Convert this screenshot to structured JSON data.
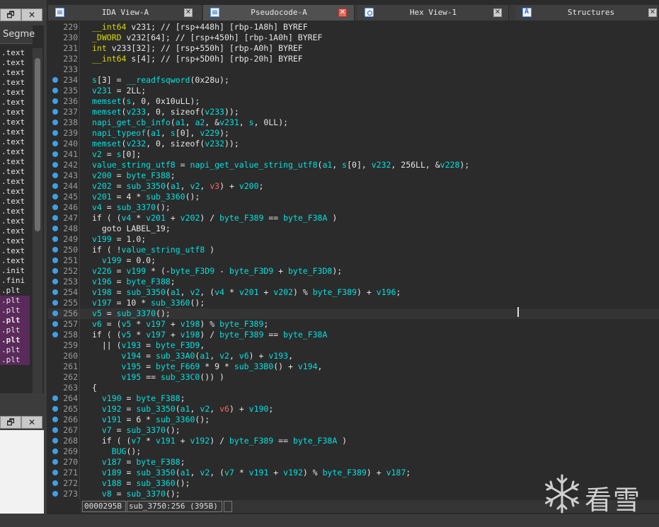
{
  "left_panel": {
    "window_buttons": [
      "🗗",
      "✕"
    ],
    "segments_header": "Segme",
    "segments": [
      {
        "name": ".text",
        "plt": false,
        "bold": false
      },
      {
        "name": ".text",
        "plt": false,
        "bold": false
      },
      {
        "name": ".text",
        "plt": false,
        "bold": false
      },
      {
        "name": ".text",
        "plt": false,
        "bold": false
      },
      {
        "name": ".text",
        "plt": false,
        "bold": false
      },
      {
        "name": ".text",
        "plt": false,
        "bold": false
      },
      {
        "name": ".text",
        "plt": false,
        "bold": false
      },
      {
        "name": ".text",
        "plt": false,
        "bold": false
      },
      {
        "name": ".text",
        "plt": false,
        "bold": false
      },
      {
        "name": ".text",
        "plt": false,
        "bold": false
      },
      {
        "name": ".text",
        "plt": false,
        "bold": false
      },
      {
        "name": ".text",
        "plt": false,
        "bold": false
      },
      {
        "name": ".text",
        "plt": false,
        "bold": false
      },
      {
        "name": ".text",
        "plt": false,
        "bold": false
      },
      {
        "name": ".text",
        "plt": false,
        "bold": false
      },
      {
        "name": ".text",
        "plt": false,
        "bold": false
      },
      {
        "name": ".text",
        "plt": false,
        "bold": false
      },
      {
        "name": ".text",
        "plt": false,
        "bold": false
      },
      {
        "name": ".text",
        "plt": false,
        "bold": false
      },
      {
        "name": ".text",
        "plt": false,
        "bold": false
      },
      {
        "name": ".text",
        "plt": false,
        "bold": false
      },
      {
        "name": ".text",
        "plt": false,
        "bold": false
      },
      {
        "name": ".init",
        "plt": false,
        "bold": false
      },
      {
        "name": ".fini",
        "plt": false,
        "bold": false
      },
      {
        "name": ".plt",
        "plt": false,
        "bold": false
      },
      {
        "name": ".plt",
        "plt": true,
        "bold": false
      },
      {
        "name": ".plt",
        "plt": true,
        "bold": false
      },
      {
        "name": ".plt",
        "plt": true,
        "bold": true
      },
      {
        "name": ".plt",
        "plt": true,
        "bold": false
      },
      {
        "name": ".plt",
        "plt": true,
        "bold": true
      },
      {
        "name": ".plt",
        "plt": true,
        "bold": false
      },
      {
        "name": ".plt",
        "plt": true,
        "bold": false
      }
    ],
    "lower_buttons": [
      "🗗",
      "✕"
    ]
  },
  "tabs": [
    {
      "label": "IDA View-A",
      "icon": "document-icon",
      "active": false,
      "close_style": "grey"
    },
    {
      "label": "Pseudocode-A",
      "icon": "document-icon",
      "active": true,
      "close_style": "red"
    },
    {
      "label": "Hex View-1",
      "icon": "hex-icon",
      "active": false,
      "close_style": "grey"
    },
    {
      "label": "Structures",
      "icon": "structures-icon",
      "active": false,
      "close_style": "grey"
    }
  ],
  "code": {
    "highlighted_line": "256",
    "lines": [
      {
        "n": "229",
        "bp": false,
        "html": "<span class=\"k\">__int64</span> v231; // [rsp+448h] [rbp-1A8h] BYREF"
      },
      {
        "n": "230",
        "bp": false,
        "html": "<span class=\"k\">_DWORD</span> v232[64]; // [rsp+450h] [rbp-1A0h] BYREF"
      },
      {
        "n": "231",
        "bp": false,
        "html": "<span class=\"k\">int</span> v233[32]; // [rsp+550h] [rbp-A0h] BYREF"
      },
      {
        "n": "232",
        "bp": false,
        "html": "<span class=\"k\">__int64</span> s[4]; // [rsp+5D0h] [rbp-20h] BYREF"
      },
      {
        "n": "233",
        "bp": false,
        "html": ""
      },
      {
        "n": "234",
        "bp": true,
        "html": "<span class=\"c\">s</span>[3] = <span class=\"c\">__readfsqword</span>(0x28u);"
      },
      {
        "n": "235",
        "bp": true,
        "html": "<span class=\"c\">v231</span> = 2LL;"
      },
      {
        "n": "236",
        "bp": true,
        "html": "<span class=\"c\">memset</span>(<span class=\"c\">s</span>, 0, 0x10uLL);"
      },
      {
        "n": "237",
        "bp": true,
        "html": "<span class=\"c\">memset</span>(<span class=\"c\">v233</span>, 0, sizeof(<span class=\"c\">v233</span>));"
      },
      {
        "n": "238",
        "bp": true,
        "html": "<span class=\"c\">napi_get_cb_info</span>(<span class=\"c\">a1</span>, <span class=\"c\">a2</span>, &amp;<span class=\"c\">v231</span>, <span class=\"c\">s</span>, 0LL);"
      },
      {
        "n": "239",
        "bp": true,
        "html": "<span class=\"c\">napi_typeof</span>(<span class=\"c\">a1</span>, <span class=\"c\">s</span>[0], <span class=\"c\">v229</span>);"
      },
      {
        "n": "240",
        "bp": true,
        "html": "<span class=\"c\">memset</span>(<span class=\"c\">v232</span>, 0, sizeof(<span class=\"c\">v232</span>));"
      },
      {
        "n": "241",
        "bp": true,
        "html": "<span class=\"c\">v2</span> = <span class=\"c\">s</span>[0];"
      },
      {
        "n": "242",
        "bp": true,
        "html": "<span class=\"c\">value_string_utf8</span> = <span class=\"c\">napi_get_value_string_utf8</span>(<span class=\"c\">a1</span>, <span class=\"c\">s</span>[0], <span class=\"c\">v232</span>, 256LL, &amp;<span class=\"c\">v228</span>);"
      },
      {
        "n": "243",
        "bp": true,
        "html": "<span class=\"c\">v200</span> = <span class=\"c\">byte_F388</span>;"
      },
      {
        "n": "244",
        "bp": true,
        "html": "<span class=\"c\">v202</span> = <span class=\"c\">sub_3350</span>(<span class=\"c\">a1</span>, <span class=\"c\">v2</span>, <span class=\"r\">v3</span>) + <span class=\"c\">v200</span>;"
      },
      {
        "n": "245",
        "bp": true,
        "html": "<span class=\"c\">v201</span> = 4 * <span class=\"c\">sub_3360</span>();"
      },
      {
        "n": "246",
        "bp": true,
        "html": "<span class=\"c\">v4</span> = <span class=\"c\">sub_3370</span>();"
      },
      {
        "n": "247",
        "bp": true,
        "html": "if ( (<span class=\"c\">v4</span> * <span class=\"c\">v201</span> + <span class=\"c\">v202</span>) / <span class=\"c\">byte_F389</span> == <span class=\"c\">byte_F38A</span> )"
      },
      {
        "n": "248",
        "bp": true,
        "html": "  goto LABEL_19;"
      },
      {
        "n": "249",
        "bp": true,
        "html": "<span class=\"c\">v199</span> = 1.0;"
      },
      {
        "n": "250",
        "bp": true,
        "html": "if ( !<span class=\"c\">value_string_utf8</span> )"
      },
      {
        "n": "251",
        "bp": true,
        "html": "  <span class=\"c\">v199</span> = 0.0;"
      },
      {
        "n": "252",
        "bp": true,
        "html": "<span class=\"c\">v226</span> = <span class=\"c\">v199</span> * (-<span class=\"c\">byte_F3D9</span> - <span class=\"c\">byte_F3D9</span> + <span class=\"c\">byte_F3D8</span>);"
      },
      {
        "n": "253",
        "bp": true,
        "html": "<span class=\"c\">v196</span> = <span class=\"c\">byte_F388</span>;"
      },
      {
        "n": "254",
        "bp": true,
        "html": "<span class=\"c\">v198</span> = <span class=\"c\">sub_3350</span>(<span class=\"c\">a1</span>, <span class=\"c\">v2</span>, (<span class=\"c\">v4</span> * <span class=\"c\">v201</span> + <span class=\"c\">v202</span>) % <span class=\"c\">byte_F389</span>) + <span class=\"c\">v196</span>;"
      },
      {
        "n": "255",
        "bp": true,
        "html": "<span class=\"c\">v197</span> = 10 * <span class=\"c\">sub_3360</span>();"
      },
      {
        "n": "256",
        "bp": true,
        "html": "<span class=\"c\">v5</span> = <span class=\"c\">sub_3370</span>();"
      },
      {
        "n": "257",
        "bp": true,
        "html": "<span class=\"c\">v6</span> = (<span class=\"c\">v5</span> * <span class=\"c\">v197</span> + <span class=\"c\">v198</span>) % <span class=\"c\">byte_F389</span>;"
      },
      {
        "n": "258",
        "bp": true,
        "html": "if ( (<span class=\"c\">v5</span> * <span class=\"c\">v197</span> + <span class=\"c\">v198</span>) / <span class=\"c\">byte_F389</span> == <span class=\"c\">byte_F38A</span>"
      },
      {
        "n": "259",
        "bp": false,
        "html": "  || (<span class=\"c\">v193</span> = <span class=\"c\">byte_F3D9</span>,"
      },
      {
        "n": "260",
        "bp": false,
        "html": "      <span class=\"c\">v194</span> = <span class=\"c\">sub_33A0</span>(<span class=\"c\">a1</span>, <span class=\"c\">v2</span>, <span class=\"c\">v6</span>) + <span class=\"c\">v193</span>,"
      },
      {
        "n": "261",
        "bp": false,
        "html": "      <span class=\"c\">v195</span> = <span class=\"c\">byte_F669</span> * 9 * <span class=\"c\">sub_33B0</span>() + <span class=\"c\">v194</span>,"
      },
      {
        "n": "262",
        "bp": false,
        "html": "      <span class=\"c\">v195</span> == <span class=\"c\">sub_33C0</span>()) )"
      },
      {
        "n": "263",
        "bp": false,
        "html": "{"
      },
      {
        "n": "264",
        "bp": true,
        "html": "  <span class=\"c\">v190</span> = <span class=\"c\">byte_F388</span>;"
      },
      {
        "n": "265",
        "bp": true,
        "html": "  <span class=\"c\">v192</span> = <span class=\"c\">sub_3350</span>(<span class=\"c\">a1</span>, <span class=\"c\">v2</span>, <span class=\"r\">v6</span>) + <span class=\"c\">v190</span>;"
      },
      {
        "n": "266",
        "bp": true,
        "html": "  <span class=\"c\">v191</span> = 6 * <span class=\"c\">sub_3360</span>();"
      },
      {
        "n": "267",
        "bp": true,
        "html": "  <span class=\"c\">v7</span> = <span class=\"c\">sub_3370</span>();"
      },
      {
        "n": "268",
        "bp": true,
        "html": "  if ( (<span class=\"c\">v7</span> * <span class=\"c\">v191</span> + <span class=\"c\">v192</span>) / <span class=\"c\">byte_F389</span> == <span class=\"c\">byte_F38A</span> )"
      },
      {
        "n": "269",
        "bp": true,
        "html": "    <span class=\"c\">BUG</span>();"
      },
      {
        "n": "270",
        "bp": true,
        "html": "  <span class=\"c\">v187</span> = <span class=\"c\">byte_F388</span>;"
      },
      {
        "n": "271",
        "bp": true,
        "html": "  <span class=\"c\">v189</span> = <span class=\"c\">sub_3350</span>(<span class=\"c\">a1</span>, <span class=\"c\">v2</span>, (<span class=\"c\">v7</span> * <span class=\"c\">v191</span> + <span class=\"c\">v192</span>) % <span class=\"c\">byte_F389</span>) + <span class=\"c\">v187</span>;"
      },
      {
        "n": "272",
        "bp": true,
        "html": "  <span class=\"c\">v188</span> = <span class=\"c\">sub_3360</span>();"
      },
      {
        "n": "273",
        "bp": true,
        "html": "  <span class=\"c\">v8</span> = <span class=\"c\">sub_3370</span>();"
      }
    ]
  },
  "status": {
    "offset": "0000295B",
    "location": "sub_3750:256 (395B)"
  },
  "watermark": {
    "icon": "snowflake-icon",
    "text": "看雪"
  }
}
